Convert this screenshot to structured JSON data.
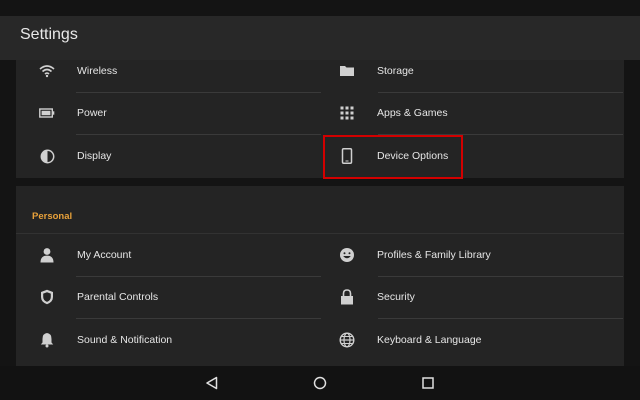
{
  "header": {
    "title": "Settings"
  },
  "device_section": {
    "items": [
      {
        "label": "Wireless",
        "icon": "wifi-icon"
      },
      {
        "label": "Storage",
        "icon": "folder-icon"
      },
      {
        "label": "Power",
        "icon": "battery-icon"
      },
      {
        "label": "Apps & Games",
        "icon": "apps-grid-icon"
      },
      {
        "label": "Display",
        "icon": "contrast-icon"
      },
      {
        "label": "Device Options",
        "icon": "phone-device-icon"
      }
    ]
  },
  "personal_section": {
    "header": "Personal",
    "items": [
      {
        "label": "My Account",
        "icon": "person-icon"
      },
      {
        "label": "Profiles & Family Library",
        "icon": "smiley-icon"
      },
      {
        "label": "Parental Controls",
        "icon": "shield-icon"
      },
      {
        "label": "Security",
        "icon": "lock-icon"
      },
      {
        "label": "Sound & Notification",
        "icon": "bell-icon"
      },
      {
        "label": "Keyboard & Language",
        "icon": "globe-icon"
      }
    ]
  },
  "highlight": {
    "target": "Device Options",
    "color": "#d30000"
  },
  "colors": {
    "accent": "#e8a13a",
    "text": "#e6e6e6",
    "icon": "#d0d0d0"
  },
  "nav": {
    "back": "back-triangle-icon",
    "home": "home-circle-icon",
    "recents": "recents-square-icon"
  }
}
